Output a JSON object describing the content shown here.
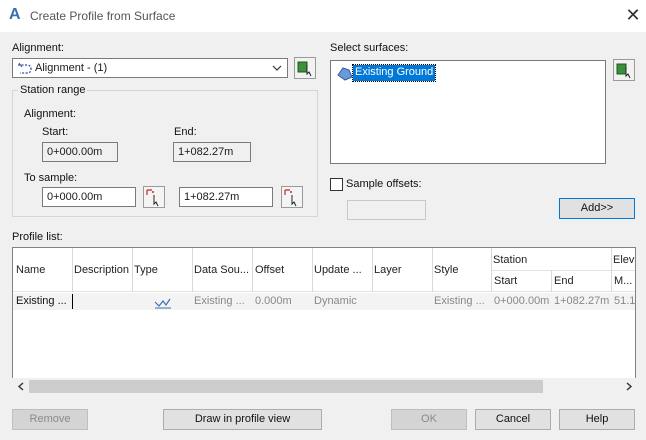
{
  "window": {
    "title": "Create Profile from Surface"
  },
  "alignment": {
    "label": "Alignment:",
    "value": "Alignment - (1)"
  },
  "station_range": {
    "title": "Station range",
    "alignment_label": "Alignment:",
    "start_label": "Start:",
    "end_label": "End:",
    "start_value": "0+000.00m",
    "end_value": "1+082.27m",
    "to_sample_label": "To sample:",
    "sample_start": "0+000.00m",
    "sample_end": "1+082.27m"
  },
  "surfaces": {
    "label": "Select surfaces:",
    "items": [
      "Existing Ground"
    ]
  },
  "sample_offsets": {
    "label": "Sample offsets:",
    "checked": false,
    "value": ""
  },
  "add_button": "Add>>",
  "profile_list": {
    "label": "Profile list:",
    "group_header_station": "Station",
    "group_header_elevation": "Eleva",
    "columns": [
      "Name",
      "Description",
      "Type",
      "Data Sou...",
      "Offset",
      "Update ...",
      "Layer",
      "Style",
      "Start",
      "End",
      "M..."
    ],
    "rows": [
      {
        "name": "Existing ...",
        "description": "",
        "data_source": "Existing ...",
        "offset": "0.000m",
        "update": "Dynamic",
        "layer": "",
        "style": "Existing ...",
        "start": "0+000.00m",
        "end": "1+082.27m",
        "min": "51.1"
      }
    ]
  },
  "buttons": {
    "remove": "Remove",
    "draw": "Draw in profile view",
    "ok": "OK",
    "cancel": "Cancel",
    "help": "Help"
  }
}
